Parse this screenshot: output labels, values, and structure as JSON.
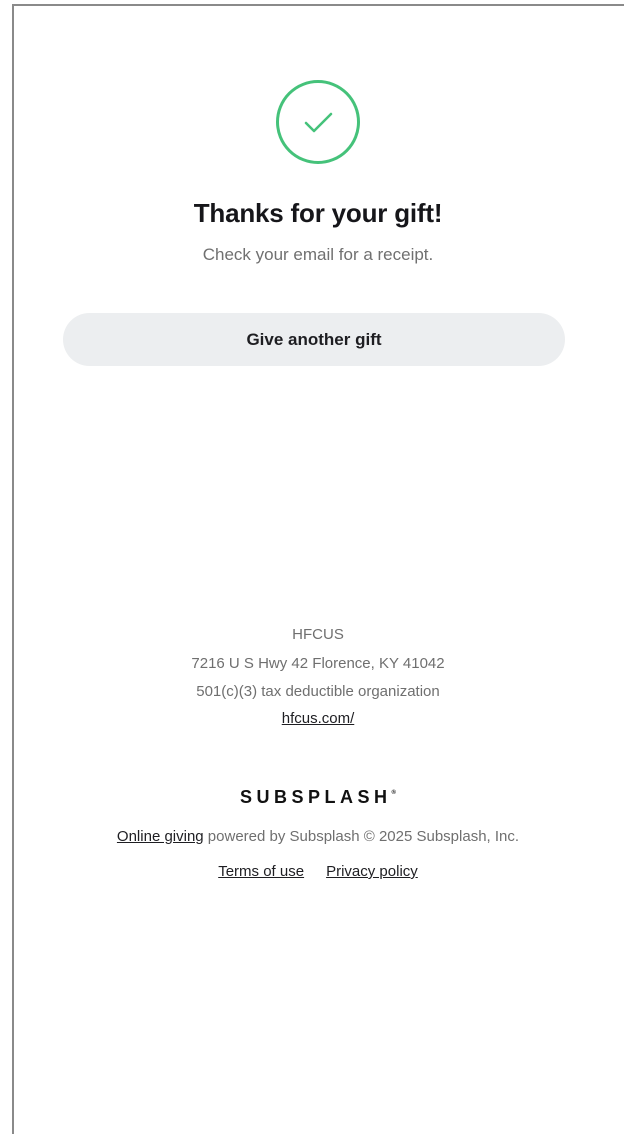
{
  "colors": {
    "success_green": "#45c27a",
    "button_bg": "#eceef0",
    "title_text": "#16161a",
    "muted_text": "#707070"
  },
  "confirmation": {
    "icon": "checkmark-circle-icon",
    "title": "Thanks for your gift!",
    "subtitle": "Check your email for a receipt.",
    "button_label": "Give another gift"
  },
  "organization": {
    "name": "HFCUS",
    "address": "7216 U S Hwy 42 Florence, KY 41042",
    "tax_status": "501(c)(3) tax deductible organization",
    "website": "hfcus.com/"
  },
  "footer": {
    "brand": "SUBSPLASH",
    "brand_mark": "®",
    "online_giving_link": "Online giving",
    "powered_by_text": " powered by Subsplash © 2025 Subsplash, Inc.",
    "terms_link": "Terms of use",
    "privacy_link": "Privacy policy"
  }
}
